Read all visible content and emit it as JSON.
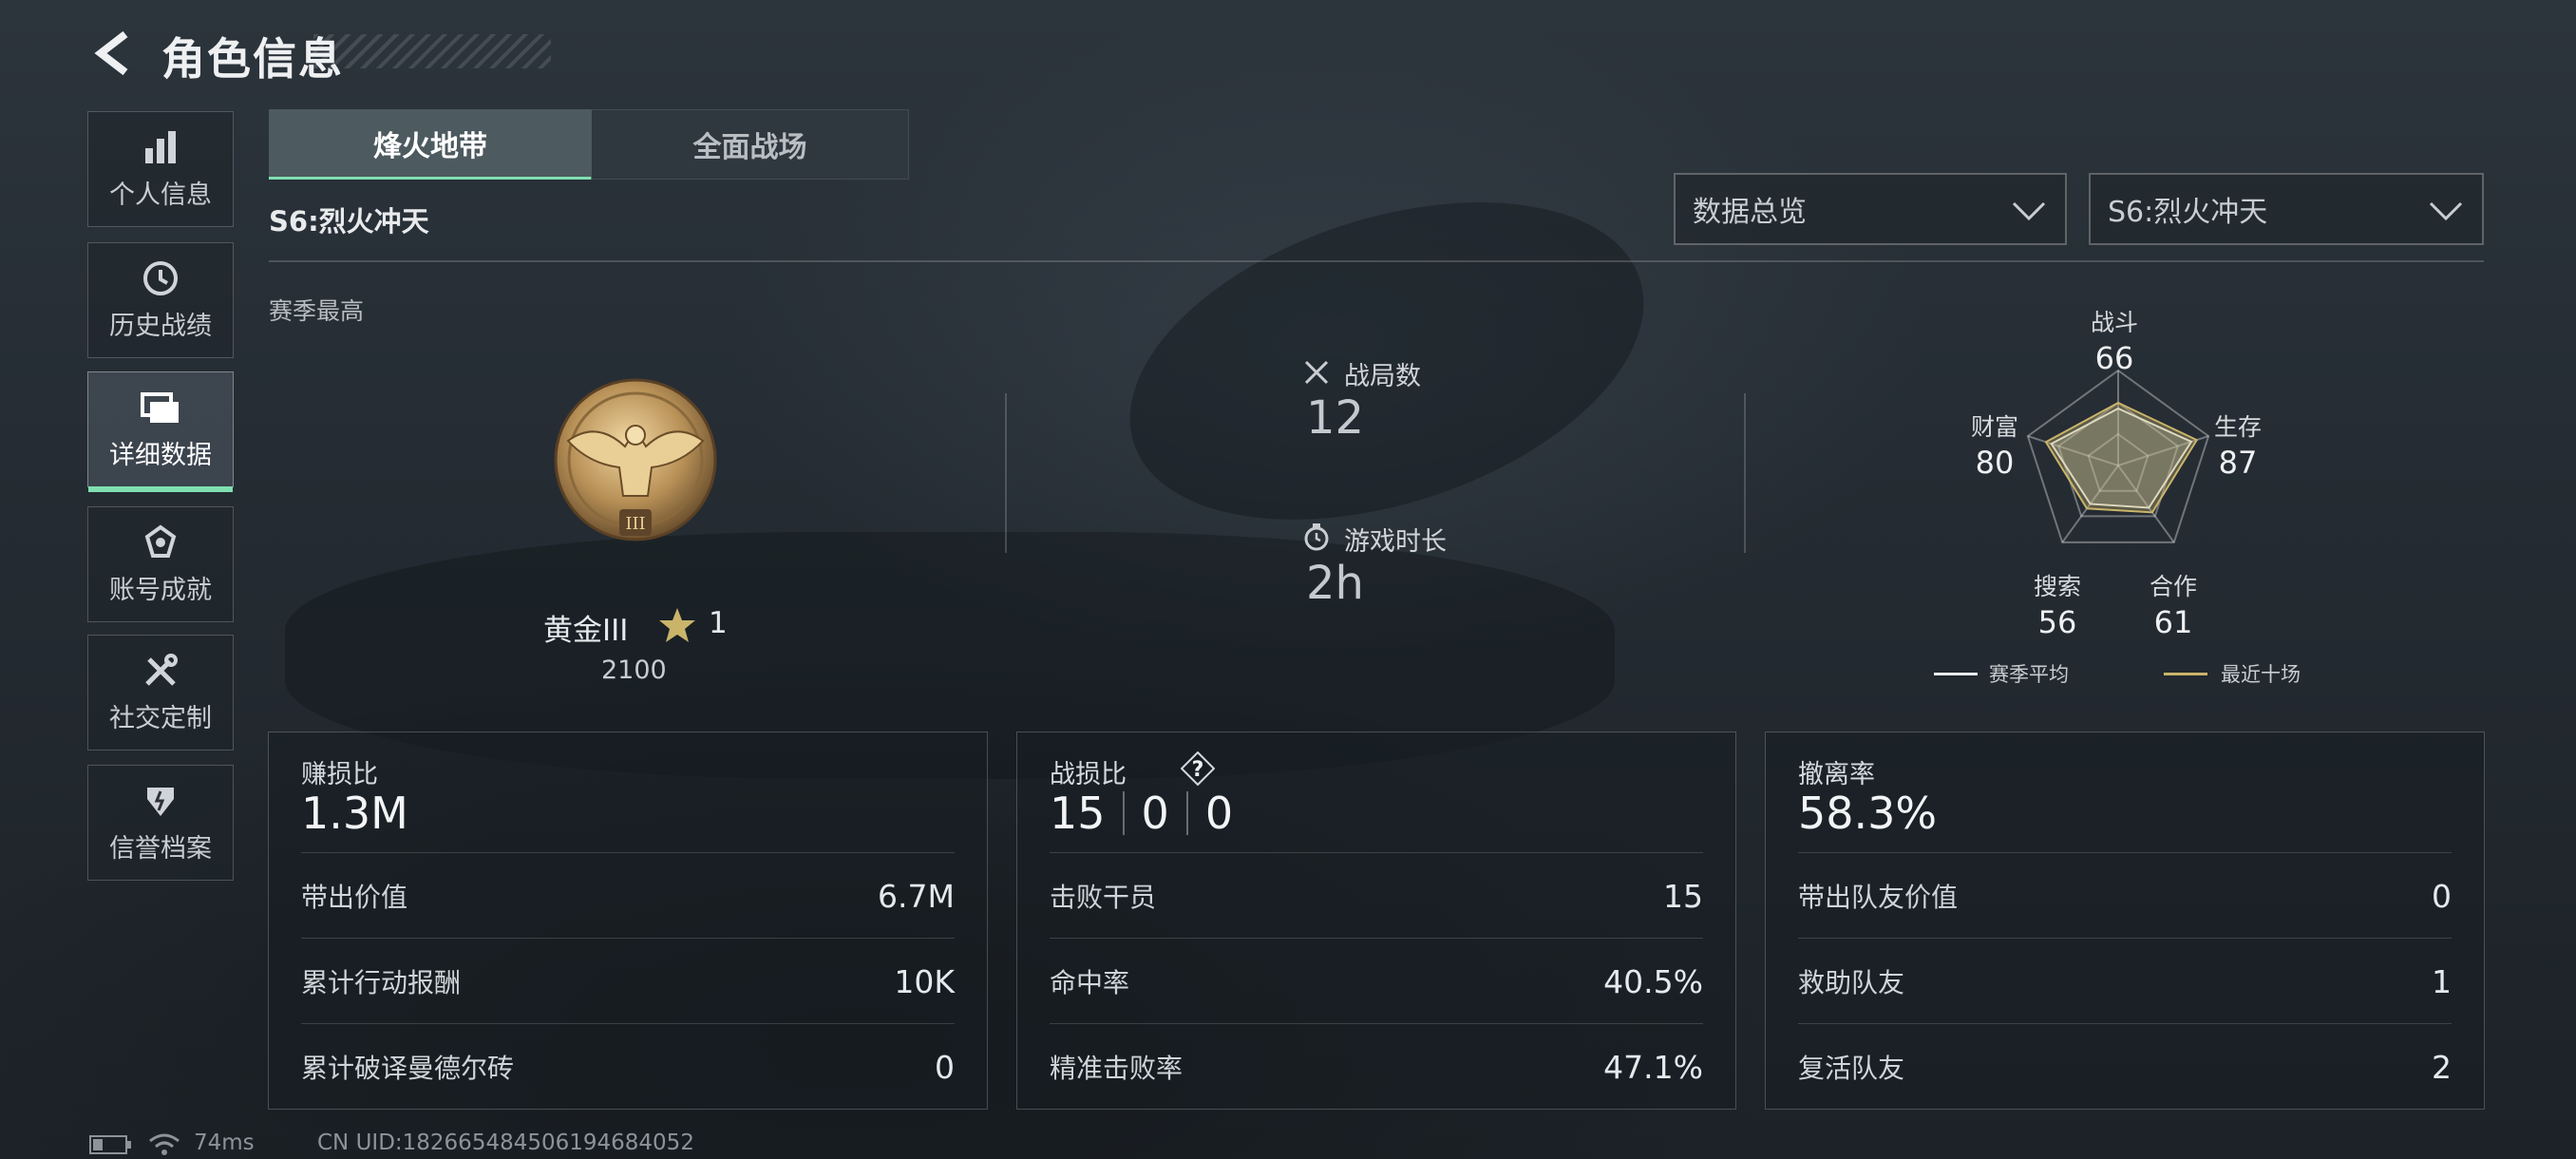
{
  "header": {
    "title": "角色信息"
  },
  "sidebar": {
    "items": [
      {
        "label": "个人信息",
        "icon": "bar-chart-icon"
      },
      {
        "label": "历史战绩",
        "icon": "history-clock-icon"
      },
      {
        "label": "详细数据",
        "icon": "folder-icon",
        "active": true
      },
      {
        "label": "账号成就",
        "icon": "badge-icon"
      },
      {
        "label": "社交定制",
        "icon": "tools-icon"
      },
      {
        "label": "信誉档案",
        "icon": "shield-icon"
      }
    ]
  },
  "tabs": [
    {
      "label": "烽火地带",
      "active": true
    },
    {
      "label": "全面战场",
      "active": false
    }
  ],
  "season_label": "S6:烈火冲天",
  "dropdowns": {
    "view": "数据总览",
    "season": "S6:烈火冲天"
  },
  "season_best": {
    "label": "赛季最高",
    "rank": "黄金III",
    "stars": "1",
    "score": "2100"
  },
  "stats": {
    "matches_label": "战局数",
    "matches_value": "12",
    "playtime_label": "游戏时长",
    "playtime_value": "2h"
  },
  "radar": {
    "axes": [
      {
        "label": "战斗",
        "value": "66"
      },
      {
        "label": "生存",
        "value": "87"
      },
      {
        "label": "合作",
        "value": "61"
      },
      {
        "label": "搜索",
        "value": "56"
      },
      {
        "label": "财富",
        "value": "80"
      }
    ],
    "legend_season_avg": "赛季平均",
    "legend_recent": "最近十场",
    "colors": {
      "season_avg": "#e8ecef",
      "recent": "#c9b46a"
    }
  },
  "panels": {
    "profit": {
      "label": "赚损比",
      "value": "1.3M",
      "rows": [
        {
          "k": "带出价值",
          "v": "6.7M"
        },
        {
          "k": "累计行动报酬",
          "v": "10K"
        },
        {
          "k": "累计破译曼德尔砖",
          "v": "0"
        }
      ]
    },
    "combat": {
      "label": "战损比",
      "kd": [
        "15",
        "0",
        "0"
      ],
      "rows": [
        {
          "k": "击败干员",
          "v": "15"
        },
        {
          "k": "命中率",
          "v": "40.5%"
        },
        {
          "k": "精准击败率",
          "v": "47.1%"
        }
      ]
    },
    "extract": {
      "label": "撤离率",
      "value": "58.3%",
      "rows": [
        {
          "k": "带出队友价值",
          "v": "0"
        },
        {
          "k": "救助队友",
          "v": "1"
        },
        {
          "k": "复活队友",
          "v": "2"
        }
      ]
    }
  },
  "status": {
    "ping": "74ms",
    "uid": "CN UID:182665484506194684052"
  },
  "accent": "#7fe0b0"
}
